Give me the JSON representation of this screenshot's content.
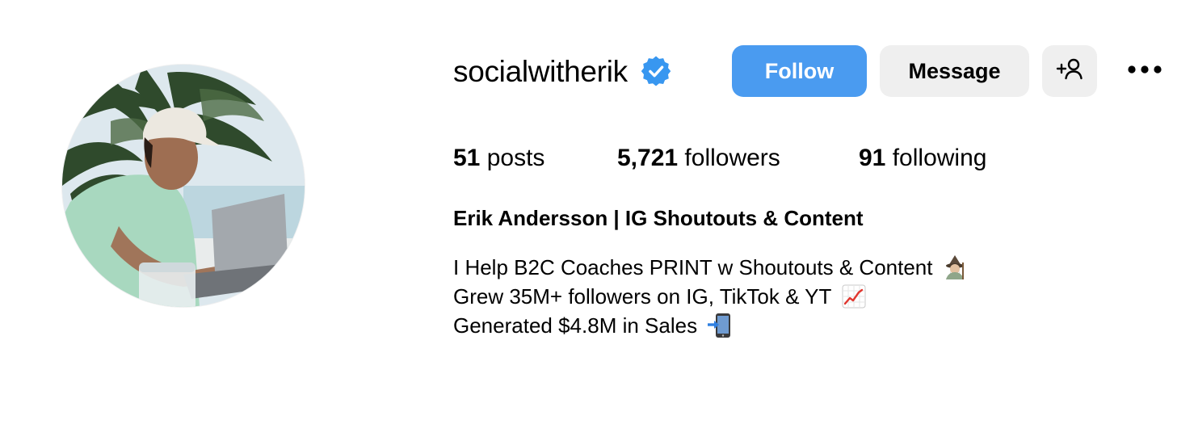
{
  "profile": {
    "username": "socialwitherik",
    "verified": true,
    "verified_badge_color": "#3897f0",
    "full_name": "Erik Andersson | IG Shoutouts & Content",
    "avatar_alt": "profile photo"
  },
  "actions": {
    "follow_label": "Follow",
    "follow_color": "#4a9bf0",
    "message_label": "Message",
    "add_user_icon": "add-person-icon",
    "more_icon": "more-options-icon"
  },
  "stats": {
    "posts_count": "51",
    "posts_label": "posts",
    "followers_count": "5,721",
    "followers_label": "followers",
    "following_count": "91",
    "following_label": "following"
  },
  "bio": {
    "lines": [
      {
        "text": "I Help B2C Coaches PRINT w Shoutouts & Content",
        "emoji": "mage-emoji-icon"
      },
      {
        "text": "Grew 35M+ followers on IG, TikTok & YT",
        "emoji": "chart-increasing-icon"
      },
      {
        "text": "Generated $4.8M in Sales",
        "emoji": "mobile-arrow-icon"
      }
    ]
  }
}
